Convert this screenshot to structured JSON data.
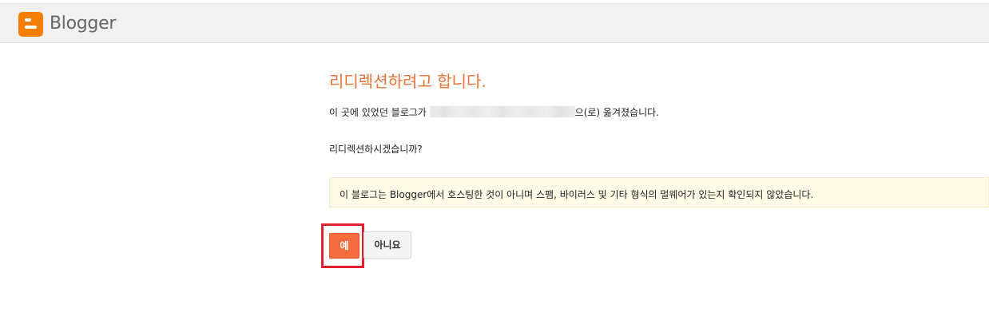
{
  "header": {
    "brand_name": "Blogger",
    "brand_color": "#f57d00"
  },
  "page": {
    "title": "리디렉션하려고 합니다.",
    "moved_text_prefix": "이 곳에 있었던 블로그가 ",
    "moved_text_suffix": "으(로) 옮겨졌습니다.",
    "question": "리디렉션하시겠습니까?",
    "warning": "이 블로그는 Blogger에서 호스팅한 것이 아니며 스팸, 바이러스 및 기타 형식의 멀웨어가 있는지 확인되지 않았습니다.",
    "title_color": "#e8733a"
  },
  "buttons": {
    "yes_label": "예",
    "no_label": "아니요",
    "yes_color": "#f26c3d"
  }
}
